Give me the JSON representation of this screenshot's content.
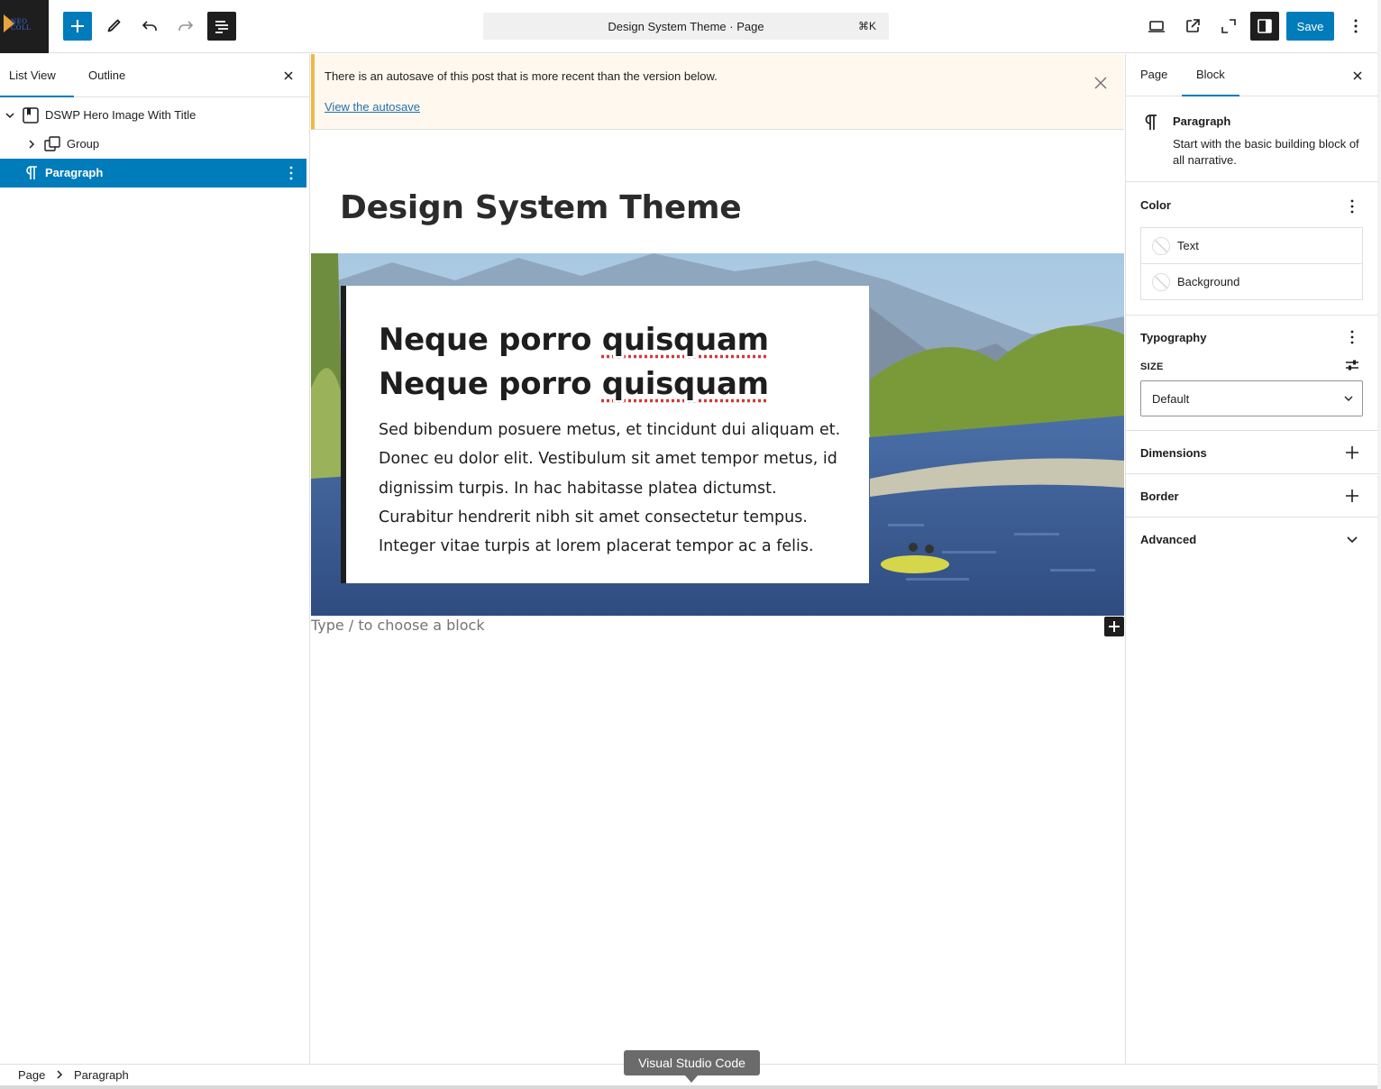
{
  "topbar": {
    "logo_text": "NEO\nCOLL",
    "document_title": "Design System Theme · Page",
    "shortcut": "⌘K",
    "save_label": "Save",
    "icons": [
      "add-block-icon",
      "tools-pencil-icon",
      "undo-icon",
      "redo-icon",
      "document-overview-icon",
      "preview-desktop-icon",
      "view-page-external-icon",
      "distraction-free-icon",
      "settings-sidebar-icon",
      "more-options-icon"
    ]
  },
  "list_view": {
    "tabs": [
      "List View",
      "Outline"
    ],
    "items": [
      {
        "label": "DSWP Hero Image With Title",
        "icon": "pattern-bookmark-icon",
        "expanded": true
      },
      {
        "label": "Group",
        "icon": "group-icon",
        "expanded": false
      },
      {
        "label": "Paragraph",
        "icon": "paragraph-icon",
        "selected": true
      }
    ]
  },
  "notice": {
    "message": "There is an autosave of this post that is more recent than the version below.",
    "link": "View the autosave"
  },
  "editor": {
    "page_title": "Design System Theme",
    "hero_heading_line1_a": "Neque porro ",
    "hero_heading_line1_b": "quisquam",
    "hero_heading_line2_a": "Neque porro ",
    "hero_heading_line2_b": "quisquam",
    "hero_body": "Sed bibendum posuere metus, et tincidunt dui aliquam et. Donec eu dolor elit. Vestibulum sit amet tempor metus, id dignissim turpis. In hac habitasse platea dictumst. Curabitur hendrerit nibh sit amet consectetur tempus. Integer vitae turpis at lorem placerat tempor ac a felis.",
    "appender_placeholder": "Type / to choose a block"
  },
  "settings": {
    "tabs": [
      "Page",
      "Block"
    ],
    "active_tab": "Block",
    "block_name": "Paragraph",
    "block_description": "Start with the basic building block of all narrative.",
    "color": {
      "title": "Color",
      "items": [
        "Text",
        "Background"
      ]
    },
    "typography": {
      "title": "Typography",
      "size_label": "SIZE",
      "size_value": "Default"
    },
    "dimensions": "Dimensions",
    "border": "Border",
    "advanced": "Advanced"
  },
  "footer": {
    "breadcrumb": [
      "Page",
      "Paragraph"
    ]
  },
  "tooltip": "Visual Studio Code",
  "colors": {
    "accent": "#007cba",
    "dark": "#1e1e1e",
    "notice_bg": "#fef8ee",
    "notice_border": "#f0b849"
  }
}
